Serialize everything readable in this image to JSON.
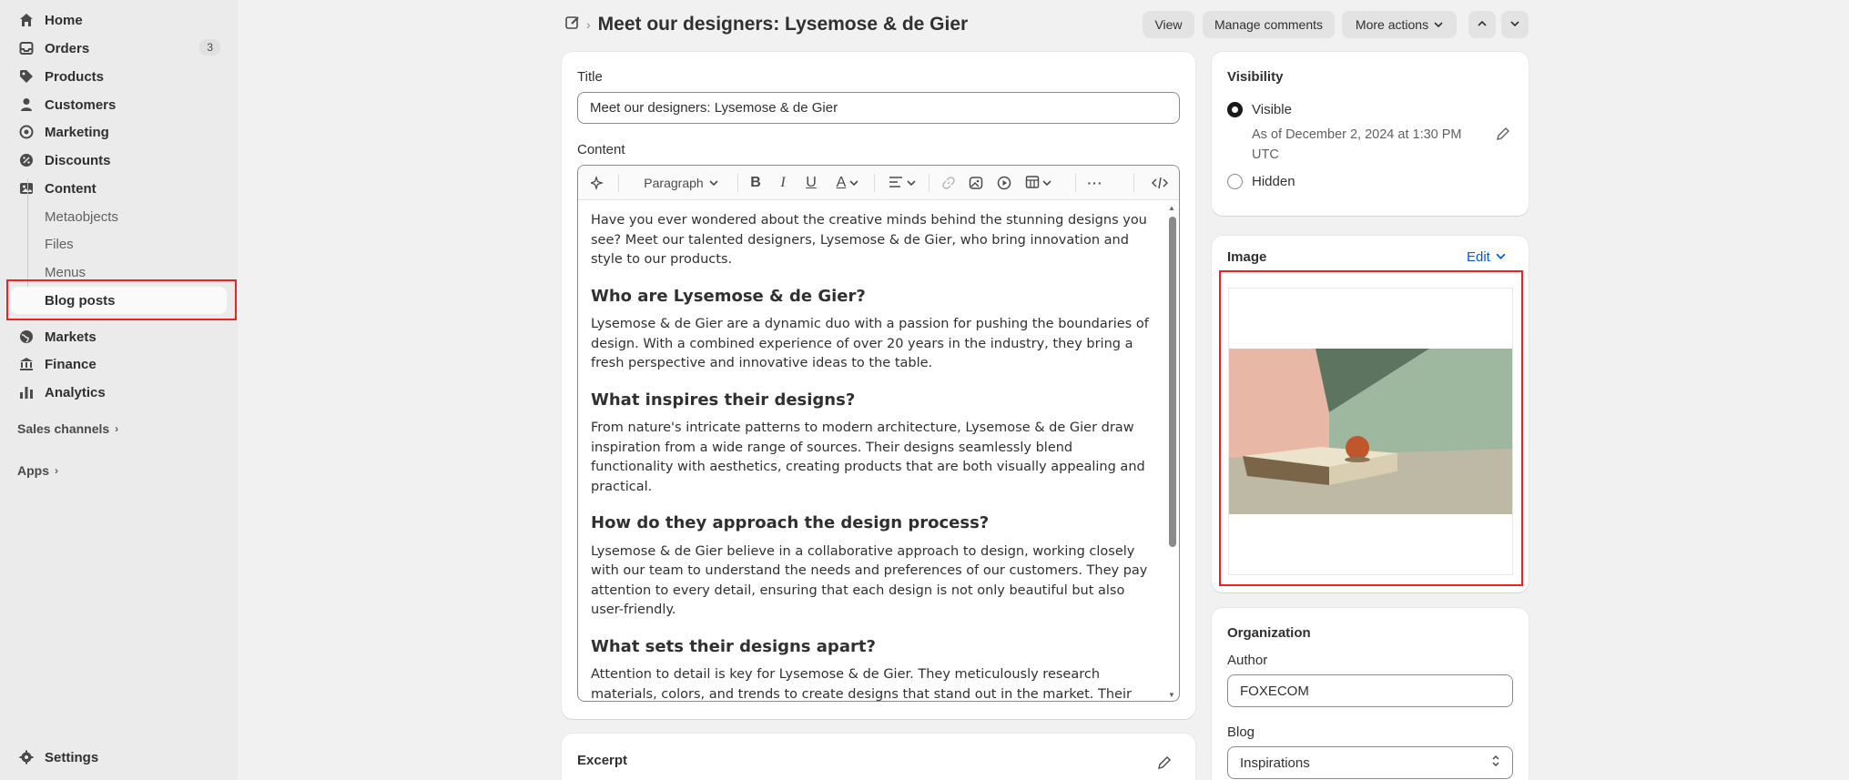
{
  "sidebar": {
    "items": [
      {
        "label": "Home",
        "icon": "home-icon"
      },
      {
        "label": "Orders",
        "icon": "inbox-icon",
        "badge": "3"
      },
      {
        "label": "Products",
        "icon": "tag-icon"
      },
      {
        "label": "Customers",
        "icon": "person-icon"
      },
      {
        "label": "Marketing",
        "icon": "target-icon"
      },
      {
        "label": "Discounts",
        "icon": "discount-icon"
      },
      {
        "label": "Content",
        "icon": "content-icon"
      }
    ],
    "content_sub": [
      "Metaobjects",
      "Files",
      "Menus",
      "Blog posts"
    ],
    "items_after": [
      {
        "label": "Markets",
        "icon": "globe-icon"
      },
      {
        "label": "Finance",
        "icon": "bank-icon"
      },
      {
        "label": "Analytics",
        "icon": "chart-icon"
      }
    ],
    "sales_channels": "Sales channels",
    "apps": "Apps",
    "settings": "Settings"
  },
  "header": {
    "title": "Meet our designers: Lysemose & de Gier",
    "view": "View",
    "manage_comments": "Manage comments",
    "more_actions": "More actions"
  },
  "main": {
    "title_label": "Title",
    "title_value": "Meet our designers: Lysemose & de Gier",
    "content_label": "Content",
    "paragraph_select": "Paragraph",
    "body": {
      "p1": "Have you ever wondered about the creative minds behind the stunning designs you see? Meet our talented designers, Lysemose & de Gier, who bring innovation and style to our products.",
      "h1": "Who are Lysemose & de Gier?",
      "p2": "Lysemose & de Gier are a dynamic duo with a passion for pushing the boundaries of design. With a combined experience of over 20 years in the industry, they bring a fresh perspective and innovative ideas to the table.",
      "h2": "What inspires their designs?",
      "p3": "From nature's intricate patterns to modern architecture, Lysemose & de Gier draw inspiration from a wide range of sources. Their designs seamlessly blend functionality with aesthetics, creating products that are both visually appealing and practical.",
      "h3": "How do they approach the design process?",
      "p4": "Lysemose & de Gier believe in a collaborative approach to design, working closely with our team to understand the needs and preferences of our customers. They pay attention to every detail, ensuring that each design is not only beautiful but also user-friendly.",
      "h4": "What sets their designs apart?",
      "p5": "Attention to detail is key for Lysemose & de Gier. They meticulously research materials, colors, and trends to create designs that stand out in the market. Their commitment to quality and innovation sets them apart from the rest."
    },
    "excerpt_label": "Excerpt"
  },
  "visibility": {
    "title": "Visibility",
    "visible": "Visible",
    "visible_note": "As of December 2, 2024 at 1:30 PM UTC",
    "hidden": "Hidden"
  },
  "image_card": {
    "title": "Image",
    "edit": "Edit"
  },
  "organization": {
    "title": "Organization",
    "author_label": "Author",
    "author_value": "FOXECOM",
    "blog_label": "Blog",
    "blog_value": "Inspirations"
  },
  "colors": {
    "highlight": "#e22222",
    "link": "#005bd3"
  }
}
